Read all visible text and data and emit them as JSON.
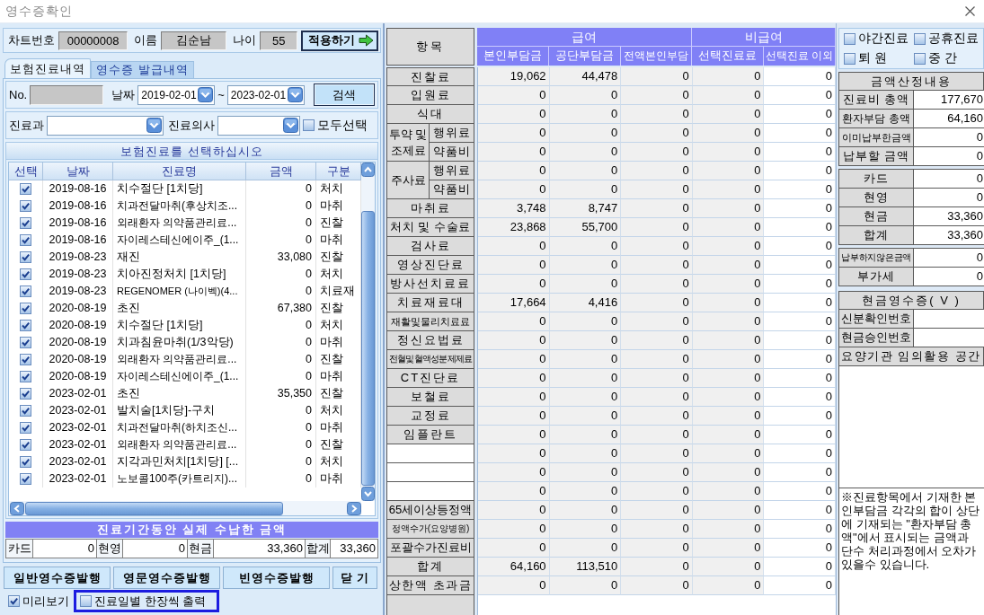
{
  "window": {
    "title": "영수증확인"
  },
  "patient": {
    "chart_no_label": "차트번호",
    "chart_no": "00000008",
    "name_label": "이름",
    "name": "김순남",
    "age_label": "나이",
    "age": "55",
    "apply_button": "적용하기"
  },
  "tabs": [
    {
      "label": "보험진료내역",
      "selected": true
    },
    {
      "label": "영수증 발급내역",
      "selected": false
    }
  ],
  "search": {
    "no_label": "No.",
    "date_label": "날짜",
    "date_from": "2019-02-01",
    "range_separator": "~",
    "date_to": "2023-02-01",
    "search_button": "검색"
  },
  "filters": {
    "department_label": "진료과",
    "doctor_label": "진료의사",
    "select_all": {
      "label": "모두선택",
      "checked": false
    }
  },
  "treatment_list": {
    "title": "보험진료를 선택하십시오",
    "columns": [
      "선택",
      "날짜",
      "진료명",
      "금액",
      "구분"
    ],
    "rows": [
      {
        "checked": true,
        "date": "2019-08-16",
        "name": "치수절단 [1치당]",
        "amount": "0",
        "category": "처치"
      },
      {
        "checked": true,
        "date": "2019-08-16",
        "name": "치과전달마취(후상치조...",
        "amount": "0",
        "category": "마취"
      },
      {
        "checked": true,
        "date": "2019-08-16",
        "name": "외래환자 의약품관리료...",
        "amount": "0",
        "category": "진찰"
      },
      {
        "checked": true,
        "date": "2019-08-16",
        "name": "자이레스테신에이주_(1...",
        "amount": "0",
        "category": "마취"
      },
      {
        "checked": true,
        "date": "2019-08-23",
        "name": "재진",
        "amount": "33,080",
        "category": "진찰"
      },
      {
        "checked": true,
        "date": "2019-08-23",
        "name": "치아진정처치 [1치당]",
        "amount": "0",
        "category": "처치"
      },
      {
        "checked": true,
        "date": "2019-08-23",
        "name": "REGENOMER (나이벡)(4...",
        "amount": "0",
        "category": "치료재"
      },
      {
        "checked": true,
        "date": "2020-08-19",
        "name": "초진",
        "amount": "67,380",
        "category": "진찰"
      },
      {
        "checked": true,
        "date": "2020-08-19",
        "name": "치수절단 [1치당]",
        "amount": "0",
        "category": "처치"
      },
      {
        "checked": true,
        "date": "2020-08-19",
        "name": "치과침윤마취(1/3악당)",
        "amount": "0",
        "category": "마취"
      },
      {
        "checked": true,
        "date": "2020-08-19",
        "name": "외래환자 의약품관리료...",
        "amount": "0",
        "category": "진찰"
      },
      {
        "checked": true,
        "date": "2020-08-19",
        "name": "자이레스테신에이주_(1...",
        "amount": "0",
        "category": "마취"
      },
      {
        "checked": true,
        "date": "2023-02-01",
        "name": "초진",
        "amount": "35,350",
        "category": "진찰"
      },
      {
        "checked": true,
        "date": "2023-02-01",
        "name": "발치술[1치당]-구치",
        "amount": "0",
        "category": "처치"
      },
      {
        "checked": true,
        "date": "2023-02-01",
        "name": "치과전달마취(하치조신...",
        "amount": "0",
        "category": "마취"
      },
      {
        "checked": true,
        "date": "2023-02-01",
        "name": "외래환자 의약품관리료...",
        "amount": "0",
        "category": "진찰"
      },
      {
        "checked": true,
        "date": "2023-02-01",
        "name": "지각과민처치[1치당] [...",
        "amount": "0",
        "category": "처치"
      },
      {
        "checked": true,
        "date": "2023-02-01",
        "name": "노보콜100주(카트리지)...",
        "amount": "0",
        "category": "마취"
      }
    ]
  },
  "paid_summary": {
    "title": "진료기간동안 실제 수납한 금액",
    "items": [
      {
        "label": "카드",
        "value": "0"
      },
      {
        "label": "현영",
        "value": "0"
      },
      {
        "label": "현금",
        "value": "33,360"
      },
      {
        "label": "합계",
        "value": "33,360"
      }
    ]
  },
  "action_buttons": [
    "일반영수증발행",
    "영문영수증발행",
    "빈영수증발행",
    "닫 기"
  ],
  "print_options": [
    {
      "label": "미리보기",
      "checked": true,
      "highlighted": false
    },
    {
      "label": "진료일별 한장씩 출력",
      "checked": false,
      "highlighted": true
    }
  ],
  "fee_table": {
    "item_header": "항목",
    "groups": [
      {
        "label": "급여",
        "columns": [
          "본인부담금",
          "공단부담금",
          "전액본인부담"
        ]
      },
      {
        "label": "비급여",
        "columns": [
          "선택진료료",
          "선택진료 이외"
        ]
      }
    ],
    "rows": [
      {
        "kind": "single",
        "label": "진찰료",
        "values": [
          "19,062",
          "44,478",
          "0",
          "0",
          "0"
        ]
      },
      {
        "kind": "single",
        "label": "입원료",
        "values": [
          "0",
          "0",
          "0",
          "0",
          "0"
        ]
      },
      {
        "kind": "single",
        "label": "식대",
        "values": [
          "0",
          "0",
          "0",
          "0",
          "0"
        ]
      },
      {
        "kind": "group",
        "label": "투약 및 조제료",
        "rows": [
          {
            "label": "행위료",
            "values": [
              "0",
              "0",
              "0",
              "0",
              "0"
            ]
          },
          {
            "label": "약품비",
            "values": [
              "0",
              "0",
              "0",
              "0",
              "0"
            ]
          }
        ]
      },
      {
        "kind": "group",
        "label": "주사료",
        "rows": [
          {
            "label": "행위료",
            "values": [
              "0",
              "0",
              "0",
              "0",
              "0"
            ]
          },
          {
            "label": "약품비",
            "values": [
              "0",
              "0",
              "0",
              "0",
              "0"
            ]
          }
        ]
      },
      {
        "kind": "single",
        "label": "마취료",
        "values": [
          "3,748",
          "8,747",
          "0",
          "0",
          "0"
        ]
      },
      {
        "kind": "single",
        "label": "처치 및 수술료",
        "values": [
          "23,868",
          "55,700",
          "0",
          "0",
          "0"
        ]
      },
      {
        "kind": "single",
        "label": "검사료",
        "values": [
          "0",
          "0",
          "0",
          "0",
          "0"
        ]
      },
      {
        "kind": "single",
        "label": "영상진단료",
        "values": [
          "0",
          "0",
          "0",
          "0",
          "0"
        ]
      },
      {
        "kind": "single",
        "label": "방사선치료료",
        "values": [
          "0",
          "0",
          "0",
          "0",
          "0"
        ]
      },
      {
        "kind": "single",
        "label": "치료재료대",
        "values": [
          "17,664",
          "4,416",
          "0",
          "0",
          "0"
        ]
      },
      {
        "kind": "single",
        "label": "재활및물리치료료",
        "values": [
          "0",
          "0",
          "0",
          "0",
          "0"
        ]
      },
      {
        "kind": "single",
        "label": "정신요법료",
        "values": [
          "0",
          "0",
          "0",
          "0",
          "0"
        ]
      },
      {
        "kind": "single",
        "label": "전혈및혈액성분제제료",
        "values": [
          "0",
          "0",
          "0",
          "0",
          "0"
        ]
      },
      {
        "kind": "single",
        "label": "CT진단료",
        "values": [
          "0",
          "0",
          "0",
          "0",
          "0"
        ]
      },
      {
        "kind": "single",
        "label": "보철료",
        "values": [
          "0",
          "0",
          "0",
          "0",
          "0"
        ]
      },
      {
        "kind": "single",
        "label": "교정료",
        "values": [
          "0",
          "0",
          "0",
          "0",
          "0"
        ]
      },
      {
        "kind": "single",
        "label": "임플란트",
        "values": [
          "0",
          "0",
          "0",
          "0",
          "0"
        ]
      },
      {
        "kind": "blank",
        "values": [
          "0",
          "0",
          "0",
          "0",
          "0"
        ]
      },
      {
        "kind": "blank",
        "values": [
          "0",
          "0",
          "0",
          "0",
          "0"
        ]
      },
      {
        "kind": "blank",
        "values": [
          "0",
          "0",
          "0",
          "0",
          "0"
        ]
      },
      {
        "kind": "single",
        "label": "65세이상등정액",
        "values": [
          "0",
          "0",
          "0",
          "0",
          "0"
        ]
      },
      {
        "kind": "single",
        "label": "정액수가(요양병원)",
        "values": [
          "0",
          "0",
          "0",
          "0",
          "0"
        ]
      },
      {
        "kind": "single",
        "label": "포괄수가진료비",
        "values": [
          "0",
          "0",
          "0",
          "0",
          "0"
        ]
      },
      {
        "kind": "single",
        "label": "합계",
        "values": [
          "64,160",
          "113,510",
          "0",
          "0",
          "0"
        ]
      },
      {
        "kind": "single",
        "label": "상한액 초과금",
        "values": [
          "0",
          "0",
          "0",
          "0",
          "0"
        ]
      }
    ]
  },
  "visit_flags": [
    {
      "label": "야간진료",
      "checked": false
    },
    {
      "label": "공휴진료",
      "checked": false
    },
    {
      "label": "퇴 원",
      "checked": false
    },
    {
      "label": "중 간",
      "checked": false
    }
  ],
  "calculation": {
    "title": "금액산정내용",
    "groups": [
      {
        "items": [
          {
            "label": "진료비 총액",
            "value": "177,670"
          },
          {
            "label": "환자부담 총액",
            "value": "64,160"
          },
          {
            "label": "이미납부한금액",
            "value": "0"
          },
          {
            "label": "납부할 금액",
            "value": "0"
          }
        ]
      },
      {
        "items": [
          {
            "label": "카드",
            "value": "0"
          },
          {
            "label": "현영",
            "value": "0"
          },
          {
            "label": "현금",
            "value": "33,360"
          },
          {
            "label": "합계",
            "value": "33,360"
          }
        ]
      },
      {
        "items": [
          {
            "label": "납부하지않은금액",
            "value": "0"
          },
          {
            "label": "부가세",
            "value": "0"
          }
        ]
      }
    ]
  },
  "cash_receipt": {
    "title": "현금영수증( V )",
    "fields": [
      {
        "label": "신분확인번호"
      },
      {
        "label": "현금승인번호"
      }
    ]
  },
  "custom_space": {
    "title": "요양기관 임의활용 공간"
  },
  "note": "※진료항목에서 기재한 본인부담금 각각의 합이 상단에 기재되는 \"환자부담 총액\"에서 표시되는 금액과 단수 처리과정에서 오차가 있을수 있습니다."
}
